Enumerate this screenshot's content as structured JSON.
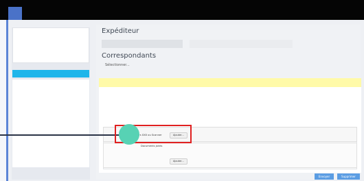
{
  "main": {
    "sender_heading": "Expéditeur",
    "recipients_heading": "Correspondants",
    "select_link": "Sélectionner..."
  },
  "upload": {
    "row1_label": "Fichiers XXX ou Scanner",
    "row1_button": "Ajouter...",
    "row2_label": "Documents joints",
    "row2_button": "Ajouter..."
  },
  "actions": {
    "send_label": "Envoyer",
    "delete_label": "Supprimer"
  },
  "colors": {
    "topbar": "#050505",
    "accent": "#4a72c8",
    "sidebar_active": "#1eb5ea",
    "highlight_band": "#fffaa8",
    "callout_border": "#e02020",
    "callout_dot": "#57d2b4",
    "primary_button": "#5b9de3"
  }
}
